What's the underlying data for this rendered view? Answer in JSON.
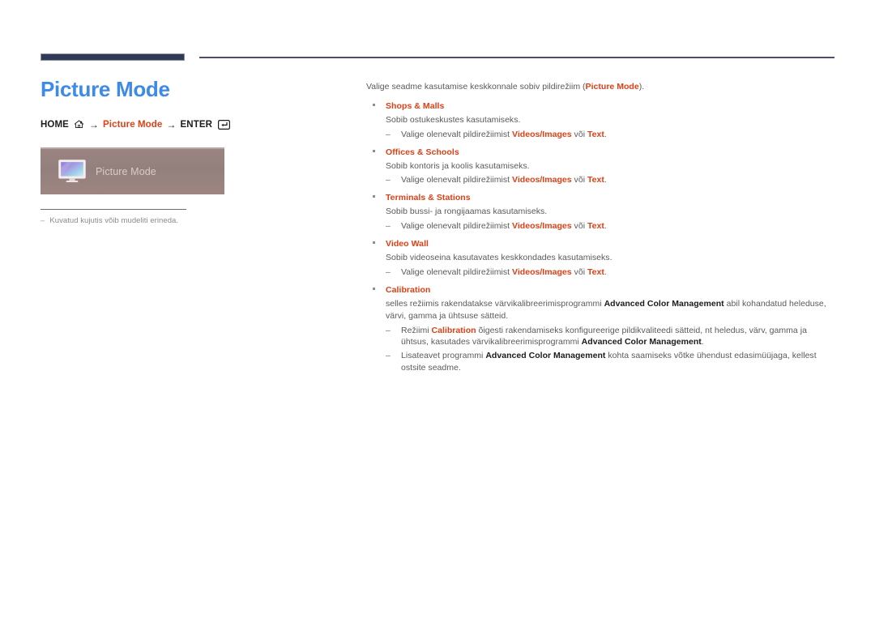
{
  "document": {
    "title": "Picture Mode",
    "breadcrumb": {
      "home_label": "HOME",
      "home_icon": "house-icon",
      "arrow": "→",
      "middle_label": "Picture Mode",
      "enter_label": "ENTER",
      "enter_icon": "enter-key-icon"
    },
    "figure": {
      "label": "Picture Mode",
      "icon": "monitor-icon",
      "background_color": "#96817e"
    },
    "note": {
      "dash": "–",
      "text": "Kuvatud kujutis võib mudeliti erineda."
    }
  },
  "colors": {
    "title_blue": "#3d8ae8",
    "accent_orange": "#dd4016",
    "body_gray": "#5a5a5a",
    "rule_navy": "#2e3a56",
    "figure_mauve": "#96817e"
  },
  "content": {
    "intro": {
      "lead": "Valige seadme kasutamise keskkonnale sobiv pildirežiim (",
      "term": "Picture Mode",
      "tail": ")."
    },
    "modes": [
      {
        "title": "Shops & Malls",
        "description": "Sobib ostukeskustes kasutamiseks.",
        "subitems": [
          {
            "lead": "Valige olenevalt pildirežiimist ",
            "term1": "Videos/Images",
            "middle": " või ",
            "term2": "Text",
            "tail": "."
          }
        ]
      },
      {
        "title": "Offices & Schools",
        "description": "Sobib kontoris ja koolis kasutamiseks.",
        "subitems": [
          {
            "lead": "Valige olenevalt pildirežiimist ",
            "term1": "Videos/Images",
            "middle": " või ",
            "term2": "Text",
            "tail": "."
          }
        ]
      },
      {
        "title": "Terminals & Stations",
        "description": "Sobib bussi- ja rongijaamas kasutamiseks.",
        "subitems": [
          {
            "lead": "Valige olenevalt pildirežiimist ",
            "term1": "Videos/Images",
            "middle": " või ",
            "term2": "Text",
            "tail": "."
          }
        ]
      },
      {
        "title": "Video Wall",
        "description": "Sobib videoseina kasutavates keskkondades kasutamiseks.",
        "subitems": [
          {
            "lead": "Valige olenevalt pildirežiimist ",
            "term1": "Videos/Images",
            "middle": " või ",
            "term2": "Text",
            "tail": "."
          }
        ]
      }
    ],
    "calibration": {
      "title": "Calibration",
      "desc_lead": "selles režiimis rakendatakse värvikalibreerimisprogrammi ",
      "desc_term": "Advanced Color Management",
      "desc_tail": " abil kohandatud heleduse, värvi, gamma ja ühtsuse sätteid.",
      "subitems": [
        {
          "lead": "Režiimi ",
          "term1": "Calibration",
          "middle": " õigesti rakendamiseks konfigureerige pildikvaliteedi sätteid, nt heledus, värv, gamma ja ühtsus, kasutades värvikalibreerimisprogrammi ",
          "term2": "Advanced Color Management",
          "tail": "."
        },
        {
          "lead": "Lisateavet programmi ",
          "term1": "Advanced Color Management",
          "middle": " kohta saamiseks võtke ühendust edasimüüjaga, kellest ostsite seadme.",
          "term2": "",
          "tail": ""
        }
      ]
    }
  }
}
